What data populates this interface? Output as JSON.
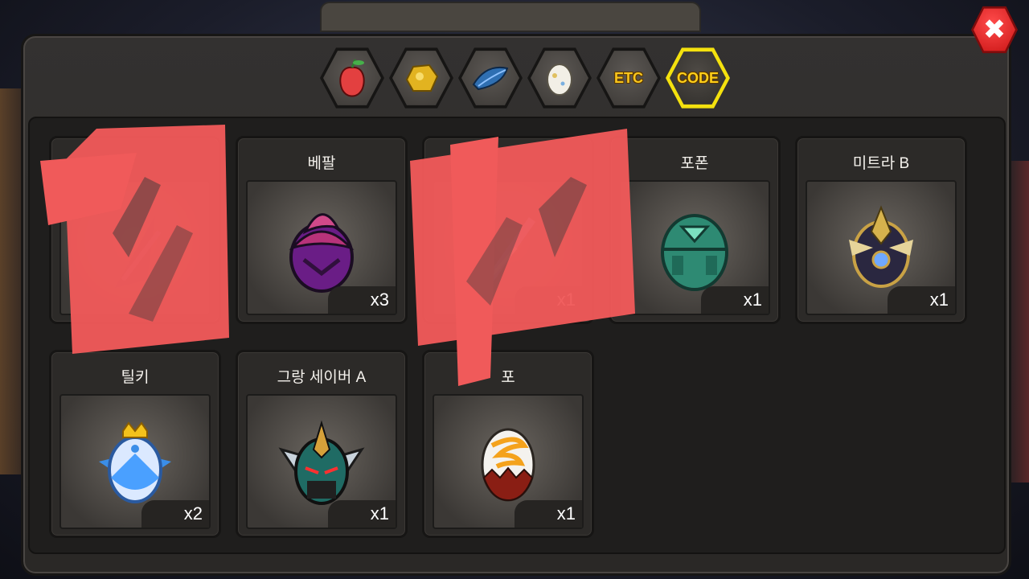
{
  "tabs": [
    {
      "icon": "fruit-icon",
      "label": ""
    },
    {
      "icon": "gold-nugget-icon",
      "label": ""
    },
    {
      "icon": "blue-feather-icon",
      "label": ""
    },
    {
      "icon": "egg-icon",
      "label": ""
    },
    {
      "icon": "etc-tab",
      "label": "ETC"
    },
    {
      "icon": "code-tab",
      "label": "CODE",
      "active": true
    }
  ],
  "close": {
    "label": "✖"
  },
  "cards": [
    {
      "name": "",
      "count": "",
      "icon": "dark-feather-egg-icon"
    },
    {
      "name": "베팔",
      "count": "x3",
      "icon": "purple-swirl-egg-icon"
    },
    {
      "name": "",
      "count": "x1",
      "icon": "crystal-egg-icon"
    },
    {
      "name": "포폰",
      "count": "x1",
      "icon": "green-triangle-egg-icon"
    },
    {
      "name": "미트라 B",
      "count": "x1",
      "icon": "armored-gold-egg-icon"
    },
    {
      "name": "틸키",
      "count": "x2",
      "icon": "crowned-blue-winged-egg-icon"
    },
    {
      "name": "그랑 세이버 A",
      "count": "x1",
      "icon": "green-helmet-egg-icon"
    },
    {
      "name": "포",
      "count": "x1",
      "icon": "flame-egg-icon"
    }
  ],
  "colors": {
    "active_tab": "#f4e10e",
    "close_button": "#c91414",
    "scribble": "#f05a5a"
  }
}
